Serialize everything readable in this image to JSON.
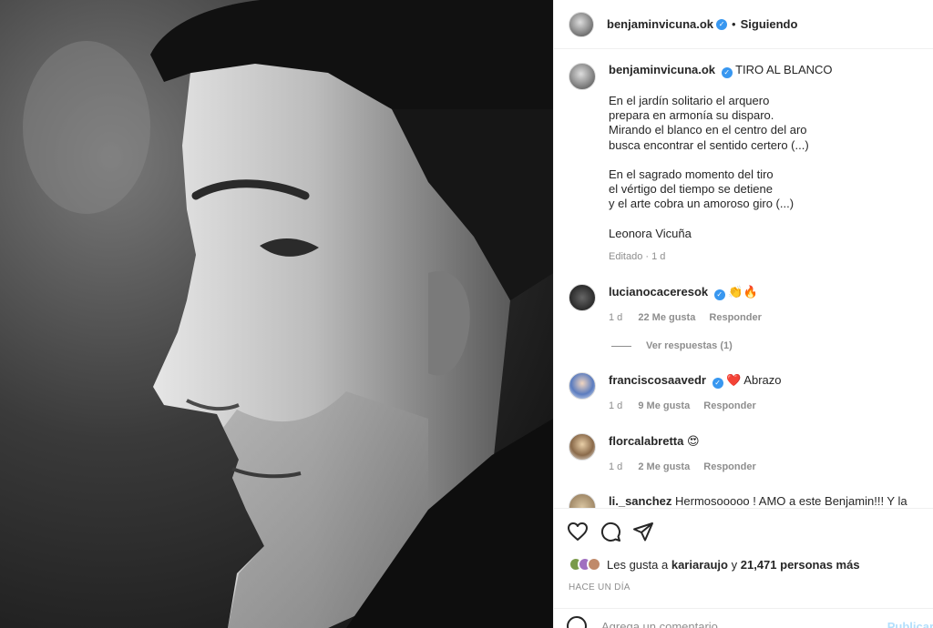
{
  "header": {
    "username": "benjaminvicuna.ok",
    "dot": "•",
    "follow_status": "Siguiendo"
  },
  "caption": {
    "username": "benjaminvicuna.ok",
    "title": "TIRO AL BLANCO",
    "body": "En el jardín solitario el arquero\nprepara en armonía su disparo.\nMirando el blanco en el centro del aro\nbusca encontrar el sentido certero (...)\n\nEn el sagrado momento del tiro\nel vértigo del tiempo se detiene\ny el arte cobra un amoroso giro (...)\n\nLeonora Vicuña",
    "meta": "Editado · 1 d"
  },
  "comments": [
    {
      "username": "lucianocaceresok",
      "text": "👏🔥",
      "time": "1 d",
      "likes": "22 Me gusta",
      "reply": "Responder",
      "view_replies": "Ver respuestas (1)"
    },
    {
      "username": "franciscosaavedr",
      "text": "Abrazo",
      "emoji": "❤️",
      "time": "1 d",
      "likes": "9 Me gusta",
      "reply": "Responder"
    },
    {
      "username": "florcalabretta",
      "text": "😍",
      "time": "1 d",
      "likes": "2 Me gusta",
      "reply": "Responder"
    },
    {
      "username": "li._sanchez",
      "text": "Hermosooooo ! AMO a este Benjamin!!! Y la"
    }
  ],
  "likes": {
    "prefix": "Les gusta a",
    "user": "kariaraujo",
    "join": "y",
    "others": "21,471 personas más"
  },
  "time_ago": "HACE UN DÍA",
  "add_comment": {
    "placeholder": "Agrega un comentario...",
    "post_label": "Publicar"
  },
  "icons": {
    "verified": "verified-badge-icon",
    "like": "heart-icon",
    "comment": "comment-icon",
    "share": "paper-plane-icon",
    "emoji": "smiley-icon"
  },
  "colors": {
    "verified": "#3897f0",
    "muted": "#8e8e8e",
    "post_button": "#b2dffc"
  }
}
